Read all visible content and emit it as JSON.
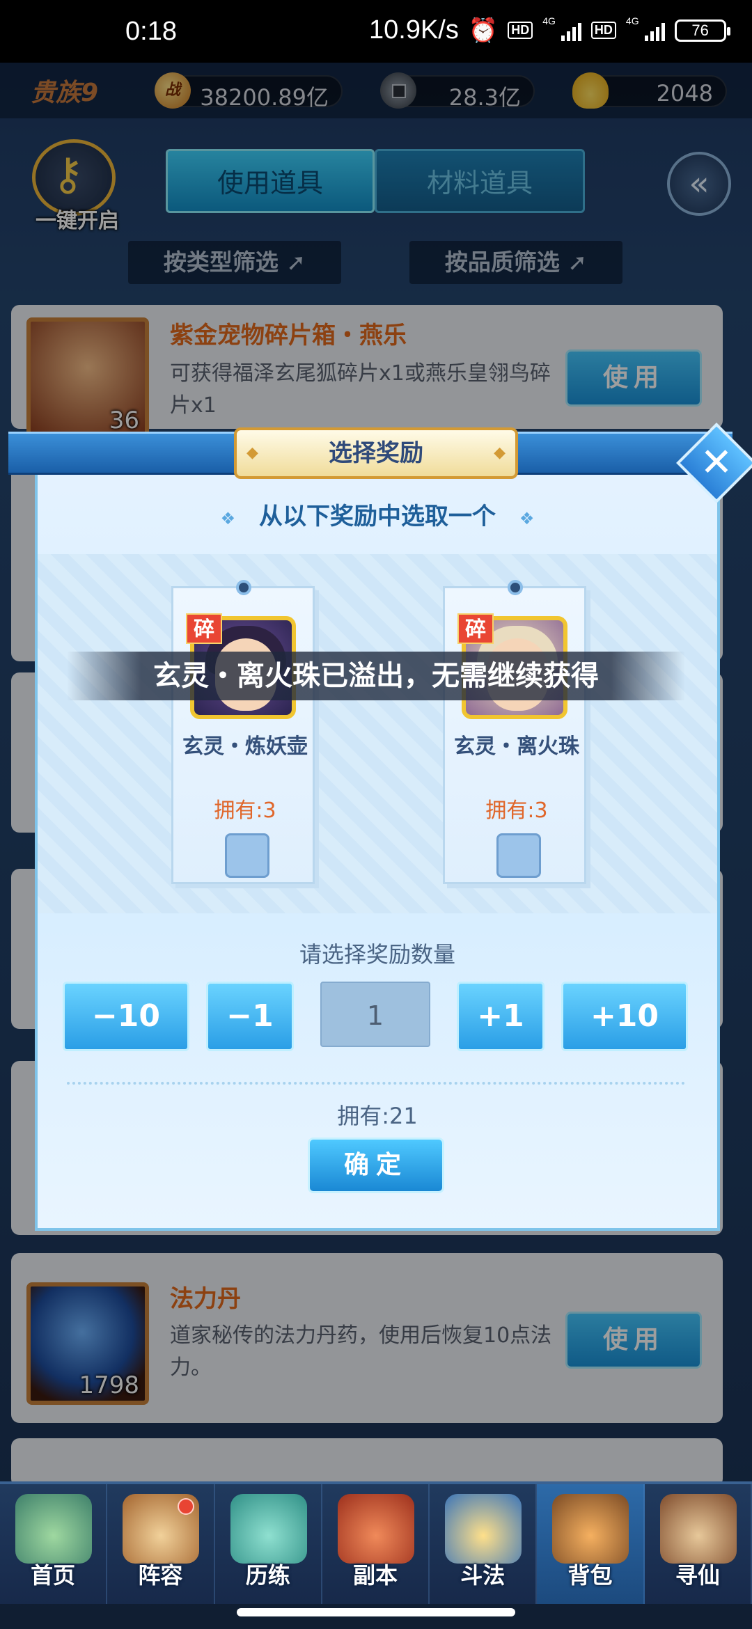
{
  "status_bar": {
    "time": "0:18",
    "net_speed": "10.9K/s",
    "hd1": "HD",
    "net1": "4G",
    "hd2": "HD",
    "net2": "4G",
    "battery": "76"
  },
  "resources": {
    "vip": "贵族9",
    "war_icon_text": "战",
    "power": "38200.89亿",
    "coins": "28.3亿",
    "gold": "2048"
  },
  "header": {
    "one_key_open": "一键开启",
    "tabs": [
      {
        "label": "使用道具",
        "active": true
      },
      {
        "label": "材料道具",
        "active": false
      }
    ],
    "filter_type": "按类型筛选",
    "filter_quality": "按品质筛选"
  },
  "items": [
    {
      "title": "紫金宠物碎片箱・燕乐",
      "desc": "可获得福泽玄尾狐碎片x1或燕乐皇翎鸟碎片x1",
      "count": "36",
      "use_label": "使用"
    },
    {
      "title": "法力丹",
      "desc": "道家秘传的法力丹药，使用后恢复10点法力。",
      "count": "1798",
      "use_label": "使用"
    }
  ],
  "modal": {
    "title": "选择奖励",
    "subtitle": "从以下奖励中选取一个",
    "shard_tag": "碎",
    "rewards": [
      {
        "name": "玄灵・炼妖壶",
        "owned": "拥有:3"
      },
      {
        "name": "玄灵・离火珠",
        "owned": "拥有:3"
      }
    ],
    "toast": "玄灵・离火珠已溢出，无需继续获得",
    "qty_label": "请选择奖励数量",
    "qty_buttons": [
      "−10",
      "−1",
      "+1",
      "+10"
    ],
    "qty_value": "1",
    "owned_total": "拥有:21",
    "confirm": "确定"
  },
  "bottom_nav": [
    {
      "label": "首页",
      "active": false,
      "badge": false
    },
    {
      "label": "阵容",
      "active": false,
      "badge": true
    },
    {
      "label": "历练",
      "active": false,
      "badge": false
    },
    {
      "label": "副本",
      "active": false,
      "badge": false
    },
    {
      "label": "斗法",
      "active": false,
      "badge": false
    },
    {
      "label": "背包",
      "active": true,
      "badge": false
    },
    {
      "label": "寻仙",
      "active": false,
      "badge": false
    }
  ],
  "colors": {
    "accent": "#2a9ee6",
    "title_orange": "#e26a1c",
    "badge_red": "#e84433"
  }
}
